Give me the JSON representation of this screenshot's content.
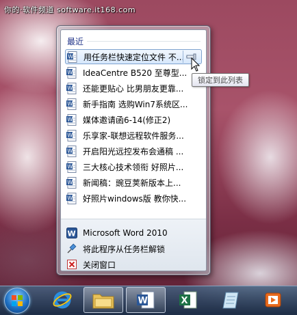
{
  "watermark": "你的·软件频道 software.it168.com",
  "jumplist": {
    "recent_title": "最近",
    "recent_items": [
      {
        "label": "用任务栏快速定位文件 不..."
      },
      {
        "label": "IdeaCentre B520  至尊型..."
      },
      {
        "label": "还能更贴心 比男朋友更靠..."
      },
      {
        "label": "新手指南 选购Win7系统区..."
      },
      {
        "label": "媒体邀请函6-14(修正2)"
      },
      {
        "label": "乐享家-联想远程软件服务..."
      },
      {
        "label": "开启阳光远控发布会通稿 ..."
      },
      {
        "label": "三大核心技术领衔 好照片..."
      },
      {
        "label": "新闻稿：豌豆荚新版本上..."
      },
      {
        "label": "好照片windows版 教你快..."
      }
    ],
    "tasks": [
      {
        "label": "Microsoft Word 2010",
        "icon": "word-icon"
      },
      {
        "label": "将此程序从任务栏解锁",
        "icon": "unpin-icon"
      },
      {
        "label": "关闭窗口",
        "icon": "close-window-icon"
      }
    ],
    "pin_tooltip": "锁定到此列表"
  },
  "taskbar": {
    "items": [
      {
        "name": "start-button",
        "icon": "windows-orb-icon"
      },
      {
        "name": "ie-button",
        "icon": "internet-explorer-icon"
      },
      {
        "name": "explorer-button",
        "icon": "folder-icon"
      },
      {
        "name": "word-button",
        "icon": "word-icon"
      },
      {
        "name": "excel-button",
        "icon": "excel-icon"
      },
      {
        "name": "notepad-button",
        "icon": "notepad-icon"
      },
      {
        "name": "media-button",
        "icon": "media-player-icon"
      }
    ]
  },
  "colors": {
    "word_blue": "#2b5797",
    "excel_green": "#1e7145",
    "section_title": "#1e3287",
    "hover_border": "#7da2ce"
  }
}
